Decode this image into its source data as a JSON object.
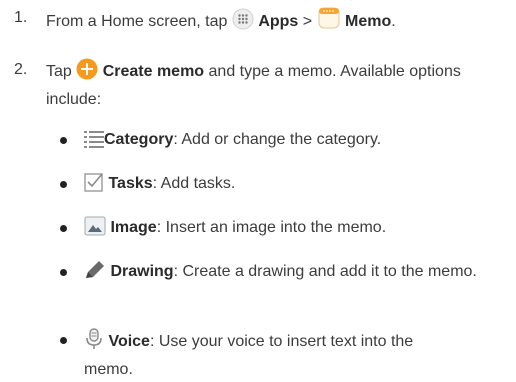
{
  "steps": [
    {
      "number": "1.",
      "text_a": "From a Home screen, tap",
      "apps_label": "Apps",
      "separator": ">",
      "memo_label": "Memo",
      "end": "."
    },
    {
      "number": "2.",
      "text_a": "Tap",
      "create_label": "Create memo",
      "text_b": "and type a memo. Available options include:"
    }
  ],
  "options": [
    {
      "icon": "category-list-icon",
      "label": "Category",
      "desc": ": Add or change the category."
    },
    {
      "icon": "tasks-checkbox-icon",
      "label": "Tasks",
      "desc": ": Add tasks."
    },
    {
      "icon": "image-icon",
      "label": "Image",
      "desc": ": Insert an image into the memo."
    },
    {
      "icon": "pencil-icon",
      "label": "Drawing",
      "desc": ": Create a drawing and add it to the memo."
    },
    {
      "icon": "microphone-icon",
      "label": "Voice",
      "desc": ": Use your voice to insert text into the memo."
    }
  ],
  "colors": {
    "accent_orange": "#f79a1c",
    "icon_gray": "#8a8a8a"
  }
}
